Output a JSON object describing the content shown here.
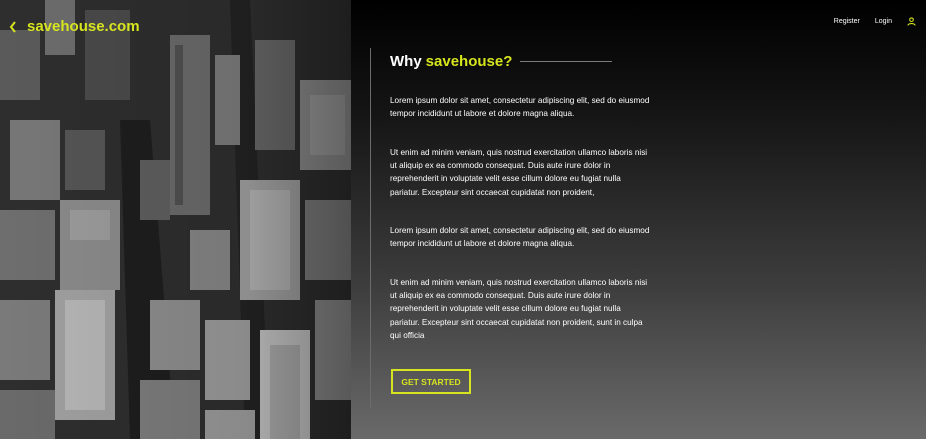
{
  "brand": {
    "name": "savehouse.com",
    "back_icon": "chevron-left-icon"
  },
  "nav": {
    "register": "Register",
    "login": "Login",
    "user_icon": "user-icon"
  },
  "colors": {
    "accent": "#d7e51e",
    "text": "#ffffff",
    "divider": "#6b6b6b"
  },
  "section": {
    "title_prefix": "Why",
    "title_accent": "savehouse?",
    "paragraphs": [
      "Lorem ipsum dolor sit amet, consectetur adipiscing elit, sed do eiusmod tempor incididunt ut labore et dolore magna aliqua.",
      "Ut enim ad minim veniam, quis nostrud exercitation ullamco laboris nisi ut aliquip ex ea commodo consequat. Duis aute irure dolor in reprehenderit in voluptate velit esse cillum dolore eu fugiat nulla pariatur. Excepteur sint occaecat cupidatat non proident,",
      "Lorem ipsum dolor sit amet, consectetur adipiscing elit, sed do eiusmod tempor incididunt ut labore et dolore magna aliqua.",
      "Ut enim ad minim veniam, quis nostrud exercitation ullamco laboris nisi ut aliquip ex ea commodo consequat. Duis aute irure dolor in reprehenderit in voluptate velit esse cillum dolore eu fugiat nulla pariatur. Excepteur sint occaecat cupidatat non proident, sunt in culpa qui officia"
    ]
  },
  "cta": {
    "label": "GET STARTED"
  }
}
